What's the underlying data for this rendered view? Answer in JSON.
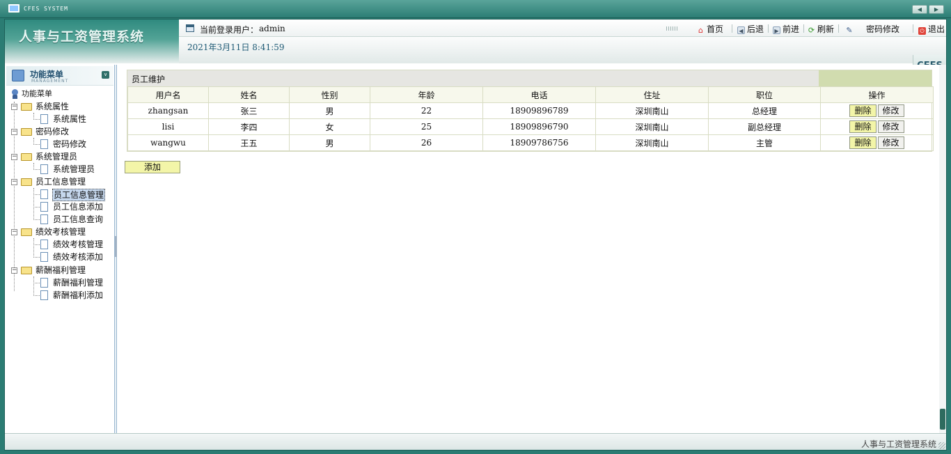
{
  "window": {
    "title": "CFES SYSTEM"
  },
  "header": {
    "brand": "人事与工资管理系统",
    "login_label": "当前登录用户：",
    "login_user": "admin",
    "datetime": "2021年3月11日 8:41:59",
    "nav": {
      "home": "首页",
      "back": "后退",
      "forward": "前进",
      "refresh": "刷新",
      "password": "密码修改",
      "logout": "退出"
    },
    "logo_tab": "CFES"
  },
  "sidebar": {
    "title": "功能菜单",
    "subtitle": "MANAGEMENT",
    "root": "功能菜单",
    "groups": [
      {
        "label": "系统属性",
        "items": [
          "系统属性"
        ]
      },
      {
        "label": "密码修改",
        "items": [
          "密码修改"
        ]
      },
      {
        "label": "系统管理员",
        "items": [
          "系统管理员"
        ]
      },
      {
        "label": "员工信息管理",
        "items": [
          "员工信息管理",
          "员工信息添加",
          "员工信息查询"
        ]
      },
      {
        "label": "绩效考核管理",
        "items": [
          "绩效考核管理",
          "绩效考核添加"
        ]
      },
      {
        "label": "薪酬福利管理",
        "items": [
          "薪酬福利管理",
          "薪酬福利添加"
        ]
      }
    ],
    "selected": "员工信息管理"
  },
  "main": {
    "panel_title": "员工维护",
    "columns": [
      "用户名",
      "姓名",
      "性别",
      "年龄",
      "电话",
      "住址",
      "职位",
      "操作"
    ],
    "rows": [
      {
        "username": "zhangsan",
        "name": "张三",
        "gender": "男",
        "age": "22",
        "phone": "18909896789",
        "address": "深圳南山",
        "position": "总经理"
      },
      {
        "username": "lisi",
        "name": "李四",
        "gender": "女",
        "age": "25",
        "phone": "18909896790",
        "address": "深圳南山",
        "position": "副总经理"
      },
      {
        "username": "wangwu",
        "name": "王五",
        "gender": "男",
        "age": "26",
        "phone": "18909786756",
        "address": "深圳南山",
        "position": "主管"
      }
    ],
    "delete_label": "删除",
    "modify_label": "修改",
    "add_label": "添加"
  },
  "status": {
    "text": "人事与工资管理系统"
  },
  "colors": {
    "frame": "#2b7c73",
    "button_yellow": "#f3f5a8",
    "header_tail": "#d1dcaf"
  }
}
